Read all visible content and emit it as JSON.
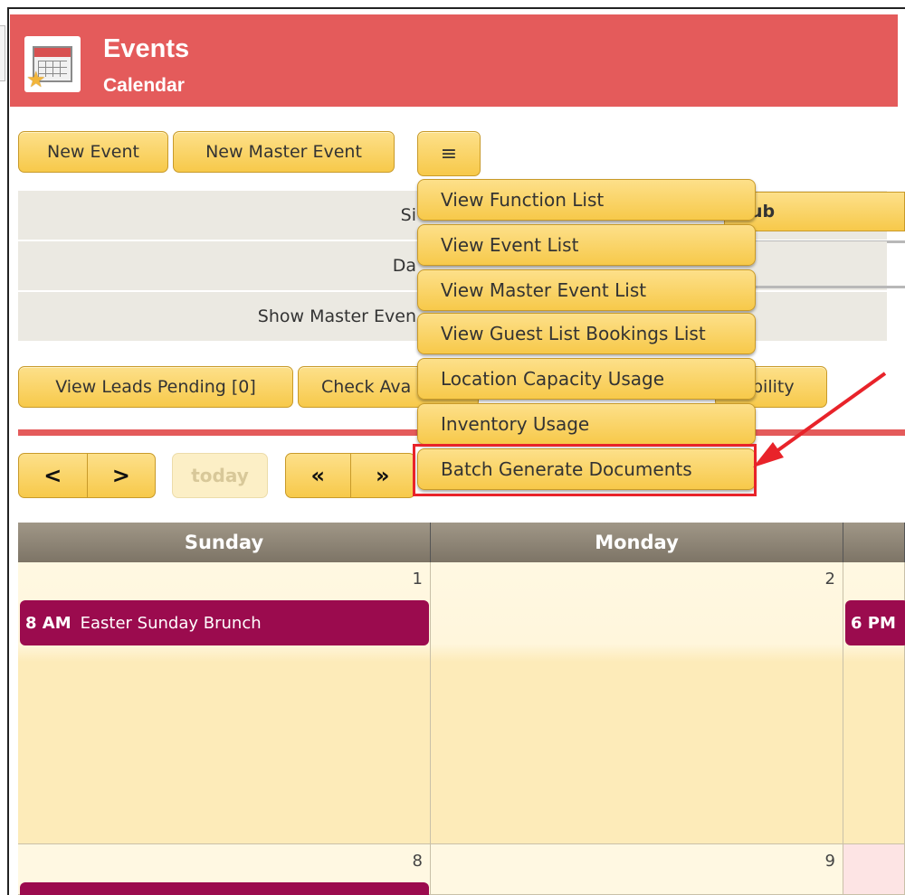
{
  "header": {
    "title": "Events",
    "subtitle": "Calendar",
    "accent": "#e45b5b"
  },
  "toolbar": {
    "new_event": "New Event",
    "new_master_event": "New Master Event",
    "menu_icon": "≡"
  },
  "filters": {
    "site_label": "Si",
    "site_value": "ub",
    "date_label": "Da",
    "show_master_label": "Show Master Even"
  },
  "actions": {
    "leads_pending": "View Leads Pending [0]",
    "check_avail": "Check Ava",
    "availability_tail": "bility"
  },
  "nav": {
    "prev": "<",
    "next": ">",
    "today": "today",
    "fast_back": "«",
    "fast_forward": "»"
  },
  "calendar": {
    "headers": [
      "Sunday",
      "Monday",
      ""
    ],
    "days": [
      "1",
      "2",
      "8",
      "9"
    ],
    "events": [
      {
        "time": "8 AM",
        "title": "Easter Sunday Brunch",
        "color": "#9b0b4e"
      },
      {
        "time": "6 PM",
        "title": "",
        "color": "#9b0b4e"
      }
    ]
  },
  "menu": {
    "items": [
      "View Function List",
      "View Event List",
      "View Master Event List",
      "View Guest List Bookings List",
      "Location Capacity Usage",
      "Inventory Usage",
      "Batch Generate Documents"
    ],
    "highlight_color": "#e8232a"
  }
}
